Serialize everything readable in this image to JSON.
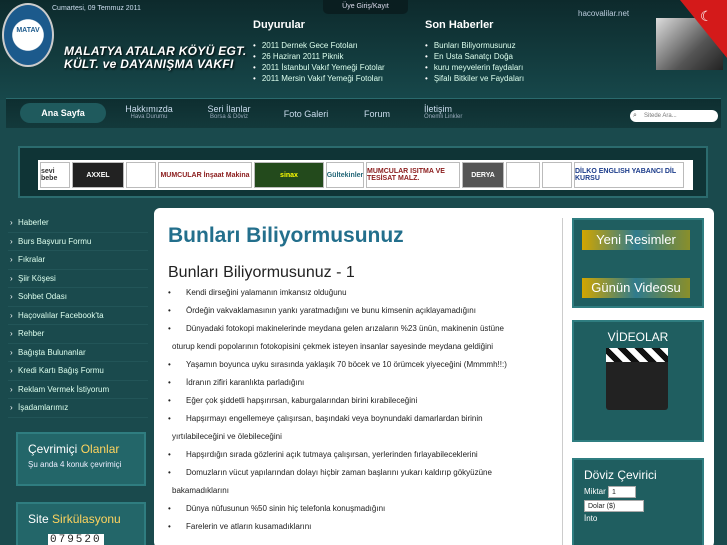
{
  "header": {
    "date": "Cumartesi, 09 Temmuz 2011",
    "logo_text": "MATAV",
    "foundation_title_line1": "MALATYA ATALAR KÖYÜ EGT.",
    "foundation_title_line2": "KÜLT. ve DAYANIŞMA VAKFI",
    "login_label": "Üye Giriş/Kayıt",
    "site": "hacovalilar.net"
  },
  "announcements": {
    "title": "Duyurular",
    "items": [
      "2011 Dernek Gece Fotoları",
      "26 Haziran 2011 Piknik",
      "2011 İstanbul Vakıf Yemeği Fotolar",
      "2011 Mersin Vakıf Yemeği Fotoları"
    ]
  },
  "news": {
    "title": "Son Haberler",
    "items": [
      "Bunları Biliyormusunuz",
      "En Usta Sanatçı Doğa",
      "kuru meyvelerin faydaları",
      "Şifalı Bitkiler ve Faydaları"
    ]
  },
  "nav": {
    "home": "Ana Sayfa",
    "about": "Hakkımızda",
    "about_sub": "Hava Durumu",
    "ads": "Seri İlanlar",
    "ads_sub": "Borsa & Döviz",
    "gallery": "Foto Galeri",
    "forum": "Forum",
    "contact": "İletişim",
    "contact_sub": "Önemli Linkler",
    "search_placeholder": "Sitede Ara..."
  },
  "sponsors": [
    "sevi bebe",
    "AXXEL",
    "",
    "MUMCULAR İnşaat Makina",
    "sinax",
    "Gültekinler",
    "MUMCULAR ISITMA VE TESİSAT MALZ.",
    "DERYA",
    "",
    "",
    "DİLKO ENGLISH YABANCI DİL KURSU"
  ],
  "sidebar": {
    "items": [
      "Haberler",
      "Burs Başvuru Formu",
      "Fıkralar",
      "Şiir Köşesi",
      "Sohbet Odası",
      "Haçovalılar Facebook'ta",
      "Rehber",
      "Bağışta Bulunanlar",
      "Kredi Kartı Bağış Formu",
      "Reklam Vermek İstiyorum",
      "İşadamlarımız"
    ],
    "online_title_a": "Çevrimiçi",
    "online_title_b": "Olanlar",
    "online_text": "Şu anda 4 konuk çevrimiçi",
    "circ_title_a": "Site",
    "circ_title_b": "Sirkülasyonu",
    "counter": "079520"
  },
  "article": {
    "title": "Bunları Biliyormusunuz",
    "subtitle": "Bunları Biliyormusunuz - 1",
    "lines": [
      {
        "b": true,
        "t": "Kendi dirseğini yalamanın imkansız olduğunu"
      },
      {
        "b": true,
        "t": "Ördeğin vakvaklamasının yankı yaratmadığını ve bunu kimsenin açıklayamadığını"
      },
      {
        "b": true,
        "t": "Dünyadaki fotokopi makinelerinde meydana gelen arızaların %23 ünün, makinenin üstüne"
      },
      {
        "b": false,
        "t": "oturup kendi popolarının fotokopisini çekmek isteyen insanlar sayesinde meydana geldiğini"
      },
      {
        "b": true,
        "t": "Yaşamın boyunca uyku sırasında yaklaşık 70 böcek ve 10 örümcek yiyeceğini (Mmmmh!!:)"
      },
      {
        "b": true,
        "t": "İdranın zifiri karanlıkta parladığını"
      },
      {
        "b": true,
        "t": "Eğer çok şiddetli hapşırırsan, kaburgalarından birini kırabileceğini"
      },
      {
        "b": true,
        "t": "Hapşırmayı engellemeye çalışırsan, başındaki veya boynundaki damarlardan birinin"
      },
      {
        "b": false,
        "t": "yırtılabileceğini ve ölebileceğini"
      },
      {
        "b": true,
        "t": "Hapşırdığın sırada gözlerini açık tutmaya çalışırsan, yerlerinden fırlayabileceklerini"
      },
      {
        "b": true,
        "t": "Domuzların vücut yapılarından dolayı hiçbir zaman başlarını yukarı kaldırıp gökyüzüne"
      },
      {
        "b": false,
        "t": "bakamadıklarını"
      },
      {
        "b": true,
        "t": "Dünya nüfusunun %50 sinin hiç telefonla konuşmadığını"
      },
      {
        "b": true,
        "t": "Farelerin ve atların kusamadıklarını"
      }
    ]
  },
  "right": {
    "new_photos": "Yeni Resimler",
    "video_of_day": "Günün Videosu",
    "videos_title": "VİDEOLAR",
    "currency_title": "Döviz Çevirici",
    "amount_label": "Miktar",
    "amount_value": "1",
    "from_value": "Dolar ($)",
    "into_label": "İnto"
  }
}
